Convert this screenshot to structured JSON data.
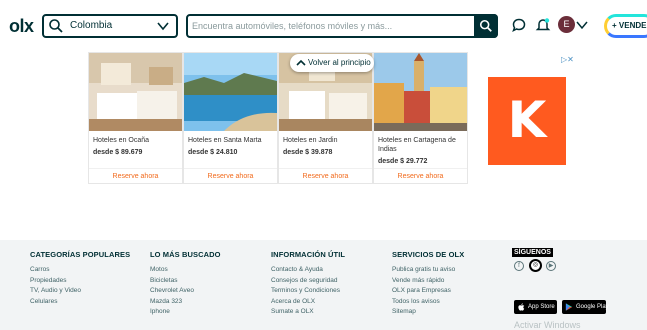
{
  "header": {
    "logo": "olx",
    "location_value": "Colombia",
    "search_placeholder": "Encuentra automóviles, teléfonos móviles y más...",
    "avatar_letter": "E",
    "sell_label": "+ VENDER"
  },
  "ad": {
    "back_to_top": "Volver al principio",
    "adchoices": "▷✕",
    "brand_letter": "K",
    "cards": [
      {
        "name": "Hoteles en Ocaña",
        "price": "desde $ 89.679",
        "cta": "Reserve ahora"
      },
      {
        "name": "Hoteles en Santa Marta",
        "price": "desde $ 24.810",
        "cta": "Reserve ahora"
      },
      {
        "name": "Hoteles en Jardin",
        "price": "desde $ 39.878",
        "cta": "Reserve ahora"
      },
      {
        "name": "Hoteles en Cartagena de Indias",
        "price": "desde $ 29.772",
        "cta": "Reserve ahora"
      }
    ]
  },
  "footer": {
    "columns": [
      {
        "title": "CATEGORÍAS POPULARES",
        "links": [
          "Carros",
          "Propiedades",
          "TV, Audio y Video",
          "Celulares"
        ]
      },
      {
        "title": "LO MÁS BUSCADO",
        "links": [
          "Motos",
          "Bicicletas",
          "Chevrolet Aveo",
          "Mazda 323",
          "Iphone"
        ]
      },
      {
        "title": "INFORMACIÓN ÚTIL",
        "links": [
          "Contacto & Ayuda",
          "Consejos de seguridad",
          "Terminos y Condiciones",
          "Acerca de OLX",
          "Sumate a OLX"
        ]
      },
      {
        "title": "SERVICIOS DE OLX",
        "links": [
          "Publica gratis tu aviso",
          "Vende más rápido",
          "OLX para Empresas",
          "Todos los avisos",
          "Sitemap"
        ]
      }
    ],
    "follow_title": "SÍGUENOS",
    "social": [
      "f",
      "◎",
      "▶"
    ],
    "app_store": "App Store",
    "google_play": "Google Play",
    "watermark": "Activar Windows"
  }
}
